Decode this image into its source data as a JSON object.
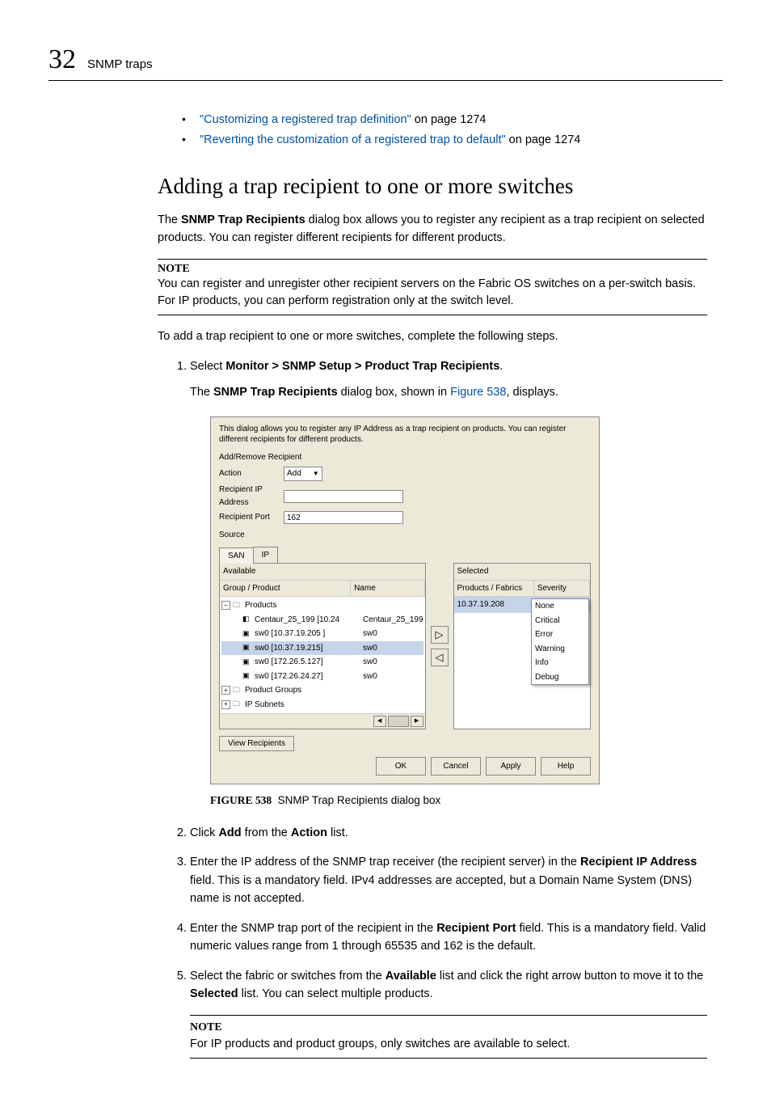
{
  "header": {
    "chapter": "32",
    "title": "SNMP traps"
  },
  "bullets": {
    "b1_link": "\"Customizing a registered trap definition\"",
    "b1_rest": " on page 1274",
    "b2_link": "\"Reverting the customization of a registered trap to default\"",
    "b2_rest": " on page 1274"
  },
  "section_title": "Adding a trap recipient to one or more switches",
  "intro": {
    "pre": "The ",
    "bold": "SNMP Trap Recipients",
    "post": " dialog box allows you to register any recipient as a trap recipient on selected products. You can register different recipients for different products."
  },
  "note1": {
    "label": "NOTE",
    "text": "You can register and unregister other recipient servers on the Fabric OS switches on a per-switch basis. For IP products, you can perform registration only at the switch level."
  },
  "lead": "To add a trap recipient to one or more switches, complete the following steps.",
  "step1": {
    "pre": "Select ",
    "bold": "Monitor > SNMP Setup > Product Trap Recipients",
    "post": ".",
    "sub_pre": "The ",
    "sub_bold": "SNMP Trap Recipients",
    "sub_mid": " dialog box, shown in ",
    "sub_link": "Figure 538",
    "sub_end": ", displays."
  },
  "dialog": {
    "intro": "This dialog allows you to register any IP Address as a trap recipient on products. You can register different recipients for different products.",
    "section_label": "Add/Remove Recipient",
    "action_label": "Action",
    "action_value": "Add",
    "ip_label": "Recipient IP Address",
    "port_label": "Recipient Port",
    "port_value": "162",
    "source_label": "Source",
    "tab_san": "SAN",
    "tab_ip": "IP",
    "available_label": "Available",
    "avail_col1": "Group / Product",
    "avail_col2": "Name",
    "tree": {
      "root": "Products",
      "r1_name": "Centaur_25_199 [10.24",
      "r1_val": "Centaur_25_199",
      "r2_name": "sw0 [10.37.19.205 ]",
      "r2_val": "sw0",
      "r3_name": "sw0 [10.37.19.215]",
      "r3_val": "sw0",
      "r4_name": "sw0 [172.26.5.127]",
      "r4_val": "sw0",
      "r5_name": "sw0 [172.26.24.27]",
      "r5_val": "sw0",
      "g1": "Product Groups",
      "g2": "IP Subnets"
    },
    "selected_label": "Selected",
    "sel_col1": "Products / Fabrics",
    "sel_col2": "Severity",
    "sel_row_ip": "10.37.19.208",
    "sel_row_sev": "None",
    "sev_options": [
      "None",
      "Critical",
      "Error",
      "Warning",
      "Info",
      "Debug"
    ],
    "view_recipients": "View Recipients",
    "ok": "OK",
    "cancel": "Cancel",
    "apply": "Apply",
    "help": "Help"
  },
  "figure": {
    "num": "FIGURE 538",
    "text": "SNMP Trap Recipients dialog box"
  },
  "step2": {
    "pre": "Click ",
    "b1": "Add",
    "mid": " from the ",
    "b2": "Action",
    "post": " list."
  },
  "step3": {
    "pre": "Enter the IP address of the SNMP trap receiver (the recipient server) in the ",
    "b1": "Recipient IP Address",
    "post": " field. This is a mandatory field. IPv4 addresses are accepted, but a Domain Name System (DNS) name is not accepted."
  },
  "step4": {
    "pre": "Enter the SNMP trap port of the recipient in the ",
    "b1": "Recipient Port",
    "post": " field. This is a mandatory field. Valid numeric values range from 1 through 65535 and 162 is the default."
  },
  "step5": {
    "pre": "Select the fabric or switches from the ",
    "b1": "Available",
    "mid": " list and click the right arrow button to move it to the ",
    "b2": "Selected",
    "post": " list. You can select multiple products."
  },
  "note2": {
    "label": "NOTE",
    "text": "For IP products and product groups, only switches are available to select."
  }
}
